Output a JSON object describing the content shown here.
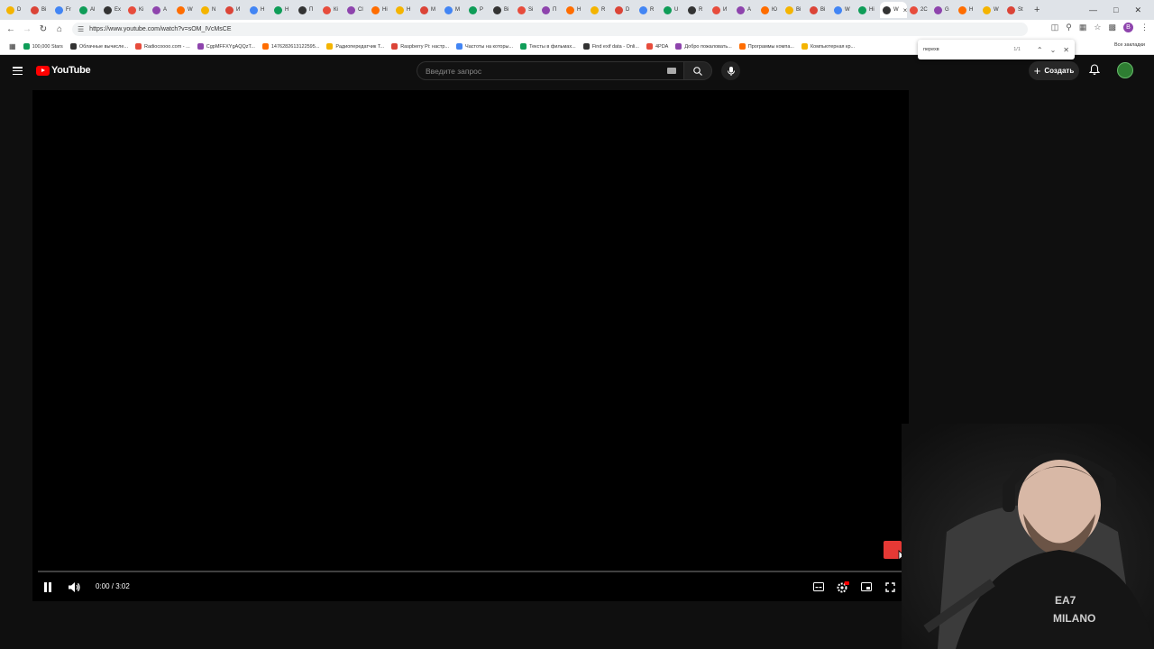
{
  "browser": {
    "tabs": [
      "D",
      "Bi",
      "Fr",
      "Al",
      "Ex",
      "Ki",
      "A",
      "W",
      "N",
      "И",
      "Н",
      "Н",
      "П",
      "Кі",
      "Сl",
      "Ні",
      "Н",
      "М",
      "М",
      "Р",
      "Вi",
      "Si",
      "П",
      "Н",
      "R",
      "D",
      "R",
      "U",
      "R",
      "И",
      "А",
      "Ю",
      "Ві",
      "Ві",
      "W",
      "Ні",
      "W",
      "2С",
      "G",
      "Н",
      "W",
      "St"
    ],
    "active_tab_label": "Н",
    "url": "https://www.youtube.com/watch?v=sOM_IVcMsCE",
    "bookmarks": [
      "100,000 Stars",
      "Облачные вычисле...",
      "Radiocoooo.com - ...",
      "CgpMFFXYgAQQzT...",
      "1476282613122595...",
      "Радиопередатчик Т...",
      "Raspberry Pi: настр...",
      "Частоты на которы...",
      "Тексты в фильмах...",
      "Find exif data - Onli...",
      "4PDA",
      "Добро пожаловать...",
      "Программы компа...",
      "Компьютерная кр..."
    ],
    "all_bookmarks_label": "Все закладки",
    "find_bar": {
      "query": "перехв",
      "count": "1/1"
    }
  },
  "youtube": {
    "logo_text": "YouTube",
    "search_placeholder": "Введите запрос",
    "create_label": "Создать"
  },
  "player": {
    "time": "0:00 / 3:02",
    "progress": 0.0,
    "state": "playing"
  },
  "colors": {
    "accent": "#ff0000",
    "background": "#0f0f0f",
    "player_bg": "#000000"
  }
}
